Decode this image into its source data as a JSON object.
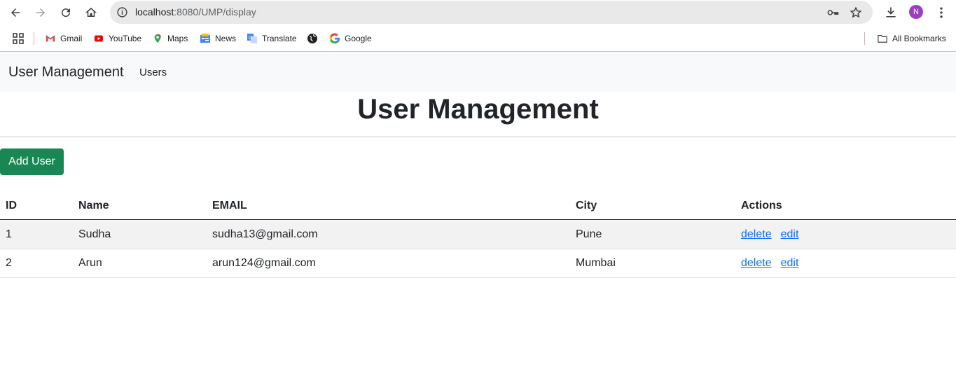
{
  "browser": {
    "url_host": "localhost",
    "url_path": ":8080/UMP/display",
    "avatar_letter": "N",
    "bookmarks": [
      {
        "label": "Gmail",
        "icon": "gmail-icon"
      },
      {
        "label": "YouTube",
        "icon": "youtube-icon"
      },
      {
        "label": "Maps",
        "icon": "maps-icon"
      },
      {
        "label": "News",
        "icon": "news-icon"
      },
      {
        "label": "Translate",
        "icon": "translate-icon"
      },
      {
        "label": "",
        "icon": "globe-icon"
      },
      {
        "label": "Google",
        "icon": "google-icon"
      }
    ],
    "all_bookmarks": "All Bookmarks"
  },
  "navbar": {
    "brand": "User Management",
    "link": "Users"
  },
  "page": {
    "title": "User Management",
    "add_button": "Add User"
  },
  "table": {
    "headers": [
      "ID",
      "Name",
      "EMAIL",
      "City",
      "Actions"
    ],
    "rows": [
      {
        "id": "1",
        "name": "Sudha",
        "email": "sudha13@gmail.com",
        "city": "Pune",
        "delete": "delete",
        "edit": "edit"
      },
      {
        "id": "2",
        "name": "Arun",
        "email": "arun124@gmail.com",
        "city": "Mumbai",
        "delete": "delete",
        "edit": "edit"
      }
    ]
  },
  "colors": {
    "accent_green": "#198754",
    "link_blue": "#0d6efd",
    "navbar_bg": "#f8f9fa"
  }
}
